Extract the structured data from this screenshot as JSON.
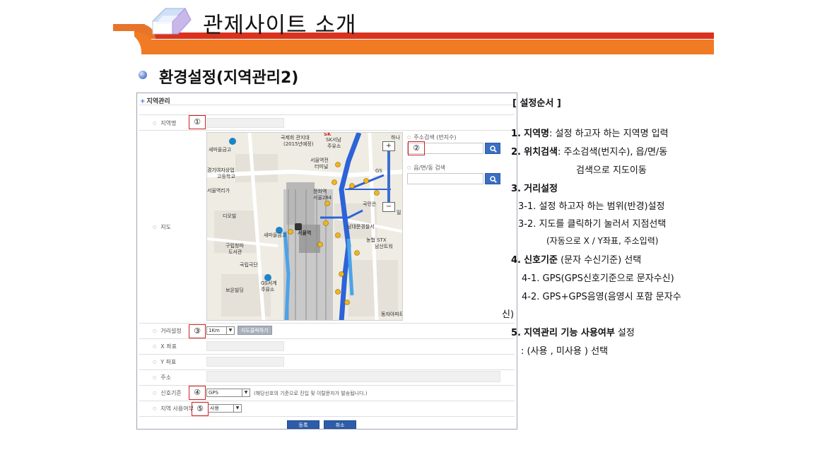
{
  "header": {
    "title": "관제사이트 소개"
  },
  "section": {
    "title": "환경설정(지역관리2)"
  },
  "panel": {
    "title": "지역관리",
    "labels": {
      "region_name": "지역명",
      "map": "지도",
      "distance": "거리설정",
      "x_coord": "X 좌표",
      "y_coord": "Y 좌표",
      "address": "주소",
      "signal": "신호기준",
      "usage": "지역 사용여부"
    },
    "address_search": {
      "lot_label": "주소검색 (번지수)",
      "town_label": "읍/면/동 검색"
    },
    "distance_select": "1Km",
    "distance_button": "지도클릭하기",
    "signal_select": "GPS",
    "signal_note": "(해당신호의 기준으로 진입 및 이탈문자가 발송됩니다.)",
    "usage_select": "사용",
    "submit_button": "등록",
    "cancel_button": "취소",
    "markers": [
      "①",
      "②",
      "③",
      "④",
      "⑤"
    ],
    "map_labels": {
      "sk": "SK",
      "national_bank": "국제회 관지대",
      "national_bank_year": "(2015년예정)",
      "sk_seonam": "SK서남",
      "gas_station": "주유소",
      "sejong_school": "새마을금고",
      "girls_school_1": "경기여자상업",
      "girls_school_2": "고등학교",
      "seoul_station_terminal_1": "서울역전",
      "seoul_station_terminal_2": "터미널",
      "seoul_station_upper": "서울역리가",
      "culture_1": "문화역",
      "culture_2": "서울284",
      "gs": "GS",
      "gukmin": "국민은",
      "di_o_building": "디오빌",
      "saemaul_2": "새마을금고",
      "seoul_station": "서울역",
      "namdaemun_police": "남대문경찰서",
      "nonghyup_stx_1": "농협 STX",
      "nonghyup_stx_2": "남산트워",
      "library_1": "구립청파",
      "library_2": "도서관",
      "national_theatre": "국립극단",
      "gs_world_1": "GS서계",
      "gs_world_2": "주유소",
      "boeun_building": "보온빌딩",
      "dongja": "동자아파트",
      "hana": "하나",
      "mil": "밀"
    }
  },
  "instructions": {
    "heading": "[ 설정순서 ]",
    "step1_num": "1.",
    "step1_bold": "지역명",
    "step1_rest": ": 설정 하고자 하는 지역명 입력",
    "step2_num": "2.",
    "step2_bold": "위치검색",
    "step2_rest": ": 주소검색(번지수), 읍/면/동",
    "step2_cont": "검색으로 지도이동",
    "step3_num": "3.",
    "step3_bold": "거리설정",
    "step3_1": "3-1. 설정 하고자 하는 범위(반경)설정",
    "step3_2": "3-2. 지도를 클릭하기 눌러서 지점선택",
    "step3_2_cont": "(자동으로 X / Y좌표, 주소입력)",
    "step4_num": "4.",
    "step4_bold": "신호기준",
    "step4_rest": "(문자 수신기준) 선택",
    "step4_1": "4-1. GPS(GPS신호기준으로 문자수신)",
    "step4_2": "4-2. GPS+GPS음영(음영시 포함 문자수",
    "step4_2_cont": "신)",
    "step5_num": "5.",
    "step5_bold": "지역관리 기능 사용여부",
    "step5_rest": "설정",
    "step5_cont": ": (사용 ,   미사용 ) 선택"
  }
}
